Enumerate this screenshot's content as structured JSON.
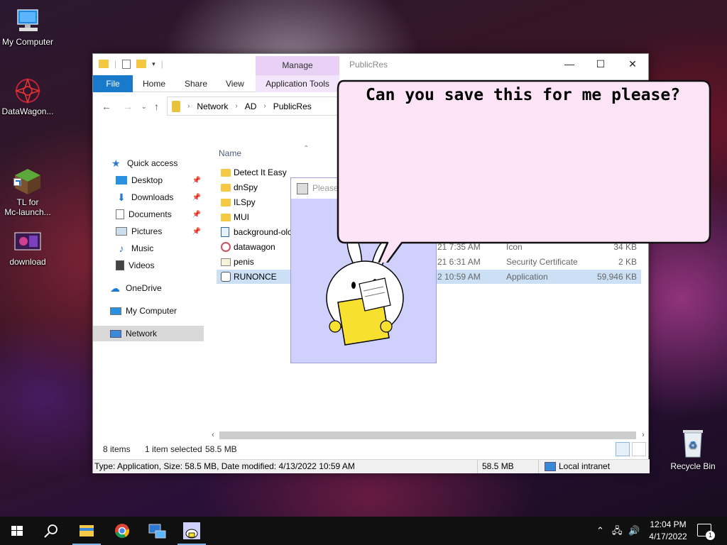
{
  "desktop": {
    "icons": [
      {
        "label": "My Computer"
      },
      {
        "label": "DataWagon..."
      },
      {
        "label": "TL for\nMc-launch..."
      },
      {
        "label": "download"
      }
    ],
    "recycle_bin": "Recycle Bin"
  },
  "explorer": {
    "title": "PublicRes",
    "manage_label": "Manage",
    "tabs": [
      "File",
      "Home",
      "Share",
      "View",
      "Application Tools"
    ],
    "breadcrumb": [
      "Network",
      "AD",
      "PublicRes"
    ],
    "nav": {
      "quick_access": "Quick access",
      "items": [
        "Desktop",
        "Downloads",
        "Documents",
        "Pictures",
        "Music",
        "Videos"
      ],
      "onedrive": "OneDrive",
      "my_computer": "My Computer",
      "network": "Network"
    },
    "column_name": "Name",
    "files": [
      {
        "name": "Detect It Easy",
        "date": "",
        "type": "",
        "size": ""
      },
      {
        "name": "dnSpy",
        "date": "",
        "type": "",
        "size": ""
      },
      {
        "name": "ILSpy",
        "date": "",
        "type": "",
        "size": ""
      },
      {
        "name": "MUI",
        "date": "",
        "type": "",
        "size": ""
      },
      {
        "name": "background-olc",
        "date": "",
        "type": "",
        "size": ""
      },
      {
        "name": "datawagon",
        "date": "21 7:35 AM",
        "type": "Icon",
        "size": "34 KB"
      },
      {
        "name": "penis",
        "date": "21 6:31 AM",
        "type": "Security Certificate",
        "size": "2 KB"
      },
      {
        "name": "RUNONCE",
        "date": "2 10:59 AM",
        "type": "Application",
        "size": "59,946 KB"
      }
    ],
    "status": {
      "items": "8 items",
      "selected": "1 item selected",
      "size": "58.5 MB"
    },
    "details": {
      "text": "Type: Application, Size: 58.5 MB, Date modified: 4/13/2022 10:59 AM",
      "size": "58.5 MB",
      "zone": "Local intranet"
    }
  },
  "popup": {
    "title": "Please"
  },
  "bubble": {
    "text": "Can you save this for me please?"
  },
  "taskbar": {
    "time": "12:04 PM",
    "date": "4/17/2022",
    "notifications": "1"
  },
  "colors": {
    "accent": "#1979ca",
    "manage_tab": "#e8d1f5",
    "bubble_fill": "#fce4f6",
    "popup_bg": "#cfd0fb",
    "folder": "#f5c945"
  }
}
